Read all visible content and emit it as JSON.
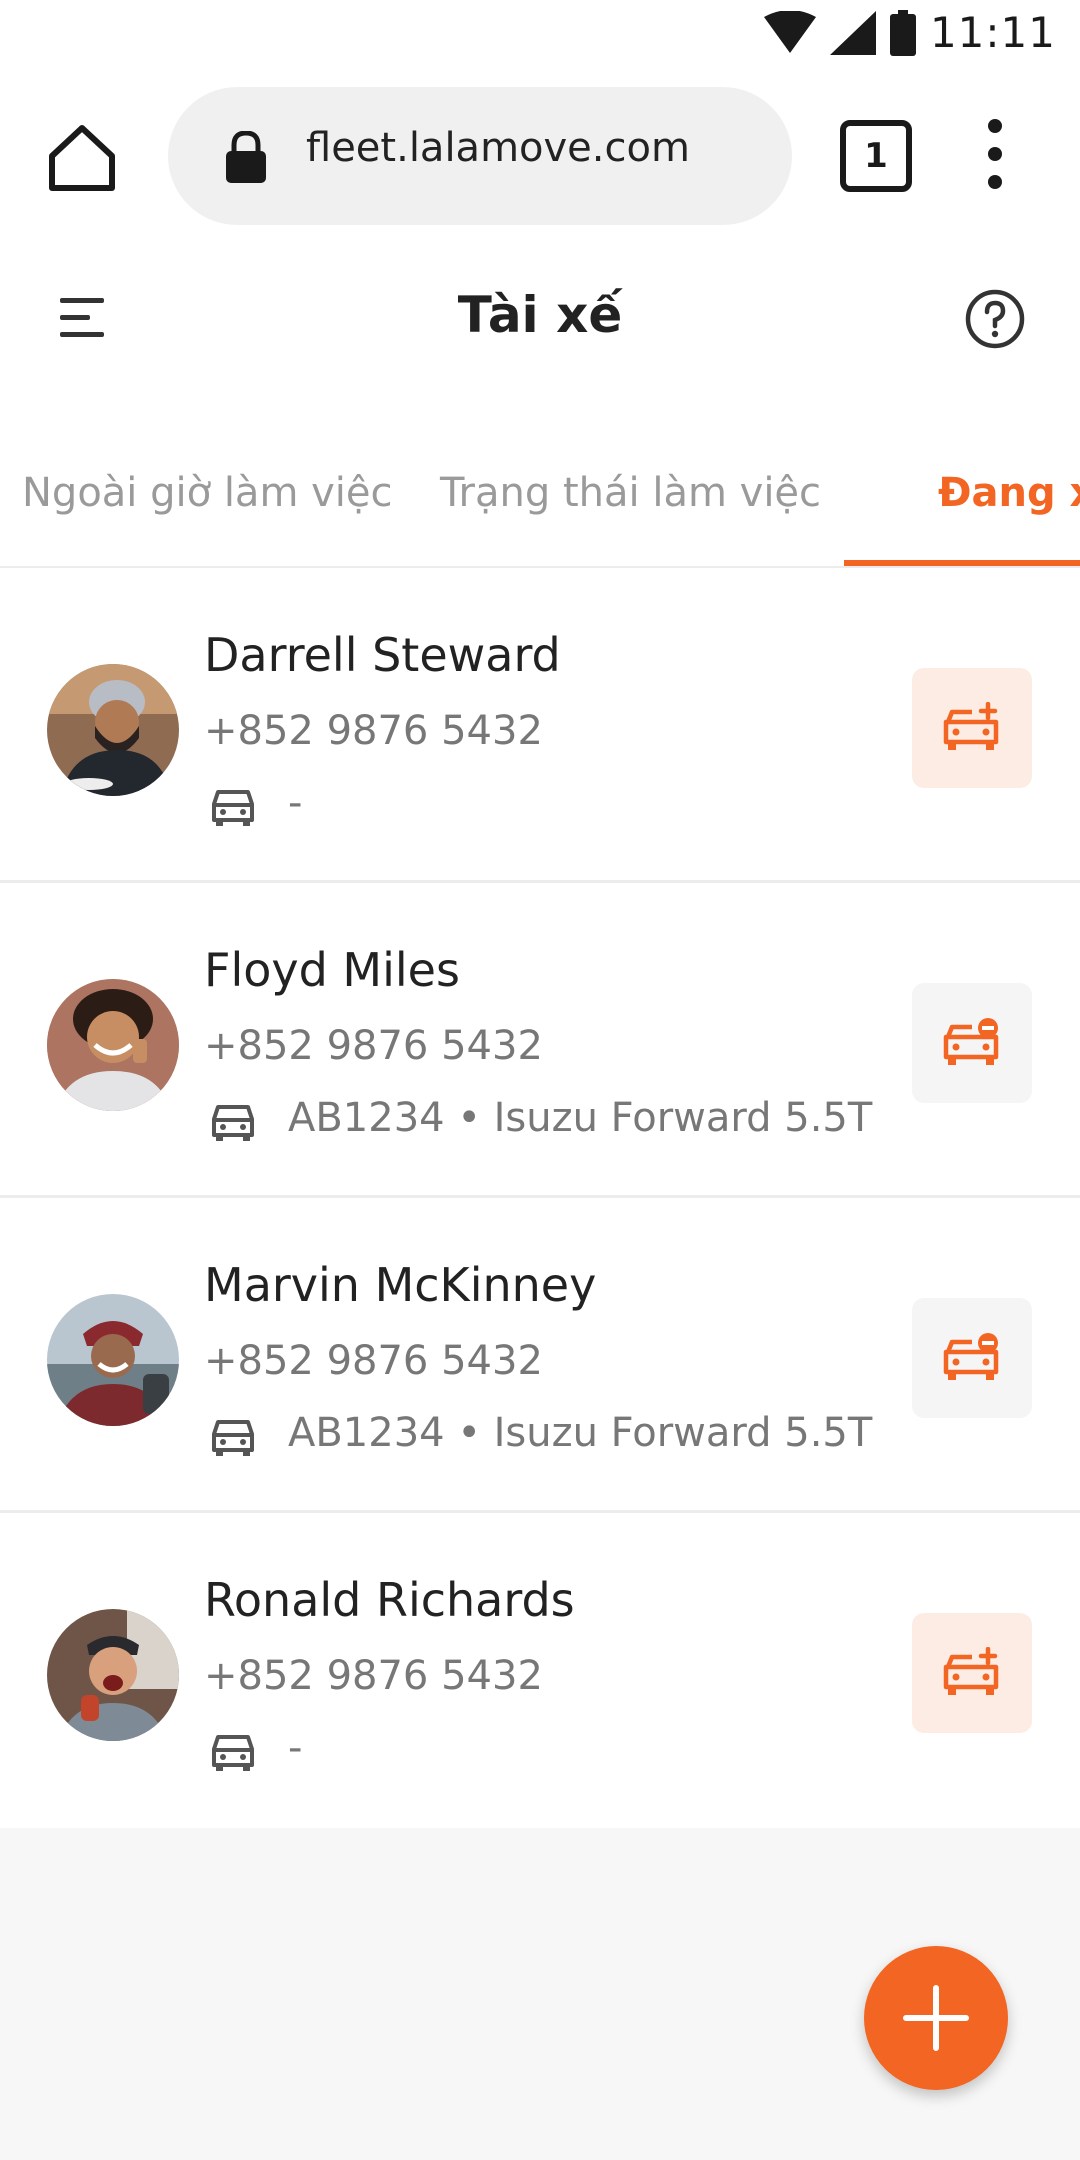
{
  "status_bar": {
    "time": "11:11",
    "icons": [
      "wifi-icon",
      "signal-icon",
      "battery-icon"
    ]
  },
  "browser": {
    "url": "fleet.lalamove.com",
    "tab_count": "1",
    "icons": [
      "home-icon",
      "lock-icon",
      "more-vert-icon"
    ]
  },
  "header": {
    "title": "Tài xế",
    "icons": [
      "hamburger-menu-icon",
      "help-icon"
    ]
  },
  "tabs": [
    {
      "label": "Ngoài giờ làm việc",
      "active": false
    },
    {
      "label": "Trạng thái làm việc",
      "active": false
    },
    {
      "label": "Đang x",
      "active": true
    }
  ],
  "drivers": [
    {
      "name": "Darrell Steward",
      "phone": "+852 9876 5432",
      "vehicle": "-",
      "action_icon": "car-add-icon"
    },
    {
      "name": "Floyd Miles",
      "phone": "+852 9876 5432",
      "vehicle": "AB1234 • Isuzu Forward 5.5T",
      "action_icon": "car-remove-icon"
    },
    {
      "name": "Marvin McKinney",
      "phone": "+852 9876 5432",
      "vehicle": "AB1234 • Isuzu Forward 5.5T",
      "action_icon": "car-remove-icon"
    },
    {
      "name": "Ronald Richards",
      "phone": "+852 9876 5432",
      "vehicle": "-",
      "action_icon": "car-add-icon"
    }
  ],
  "fab": {
    "icon": "plus-icon"
  },
  "colors": {
    "accent": "#f26522",
    "accent_light": "#fdece3",
    "text_primary": "#222222",
    "text_secondary": "#777777",
    "background": "#f7f7f7"
  }
}
